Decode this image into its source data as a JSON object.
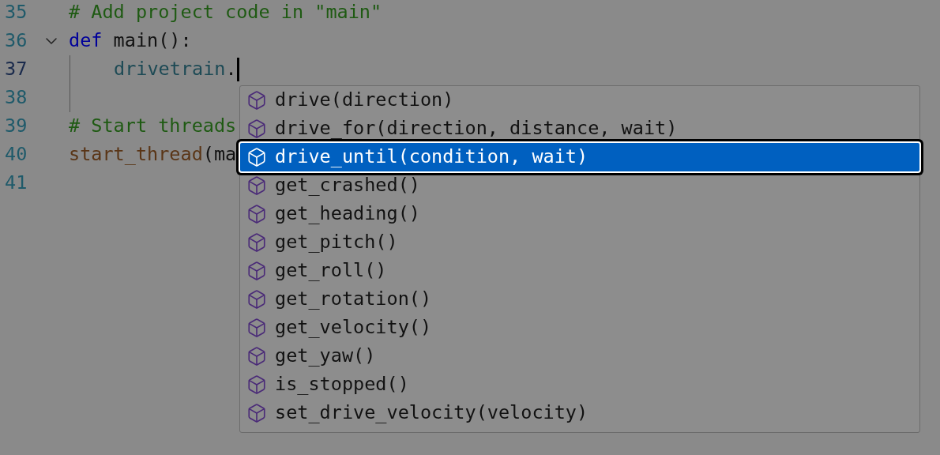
{
  "editor": {
    "lines": [
      {
        "number": "35",
        "current": false,
        "tokens": [
          {
            "kind": "comment",
            "text": "# Add project code in \"main\""
          }
        ]
      },
      {
        "number": "36",
        "current": false,
        "fold": true,
        "tokens": [
          {
            "kind": "keyword",
            "text": "def"
          },
          {
            "kind": "plain",
            "text": " main():"
          }
        ]
      },
      {
        "number": "37",
        "current": true,
        "guide": true,
        "caret": true,
        "tokens": [
          {
            "kind": "variable",
            "text": "drivetrain"
          },
          {
            "kind": "plain",
            "text": "."
          }
        ]
      },
      {
        "number": "38",
        "current": false,
        "guide": true
      },
      {
        "number": "39",
        "current": false,
        "tokens": [
          {
            "kind": "comment",
            "text": "# Start threads"
          }
        ]
      },
      {
        "number": "40",
        "current": false,
        "tokens": [
          {
            "kind": "function",
            "text": "start_thread"
          },
          {
            "kind": "plain",
            "text": "(ma"
          }
        ]
      },
      {
        "number": "41",
        "current": false
      }
    ]
  },
  "suggestions": [
    {
      "label": "drive(direction)",
      "selected": false
    },
    {
      "label": "drive_for(direction, distance, wait)",
      "selected": false
    },
    {
      "label": "drive_until(condition, wait)",
      "selected": true
    },
    {
      "label": "get_crashed()",
      "selected": false
    },
    {
      "label": "get_heading()",
      "selected": false
    },
    {
      "label": "get_pitch()",
      "selected": false
    },
    {
      "label": "get_roll()",
      "selected": false
    },
    {
      "label": "get_rotation()",
      "selected": false
    },
    {
      "label": "get_velocity()",
      "selected": false
    },
    {
      "label": "get_yaw()",
      "selected": false
    },
    {
      "label": "is_stopped()",
      "selected": false
    },
    {
      "label": "set_drive_velocity(velocity)",
      "selected": false
    }
  ]
}
